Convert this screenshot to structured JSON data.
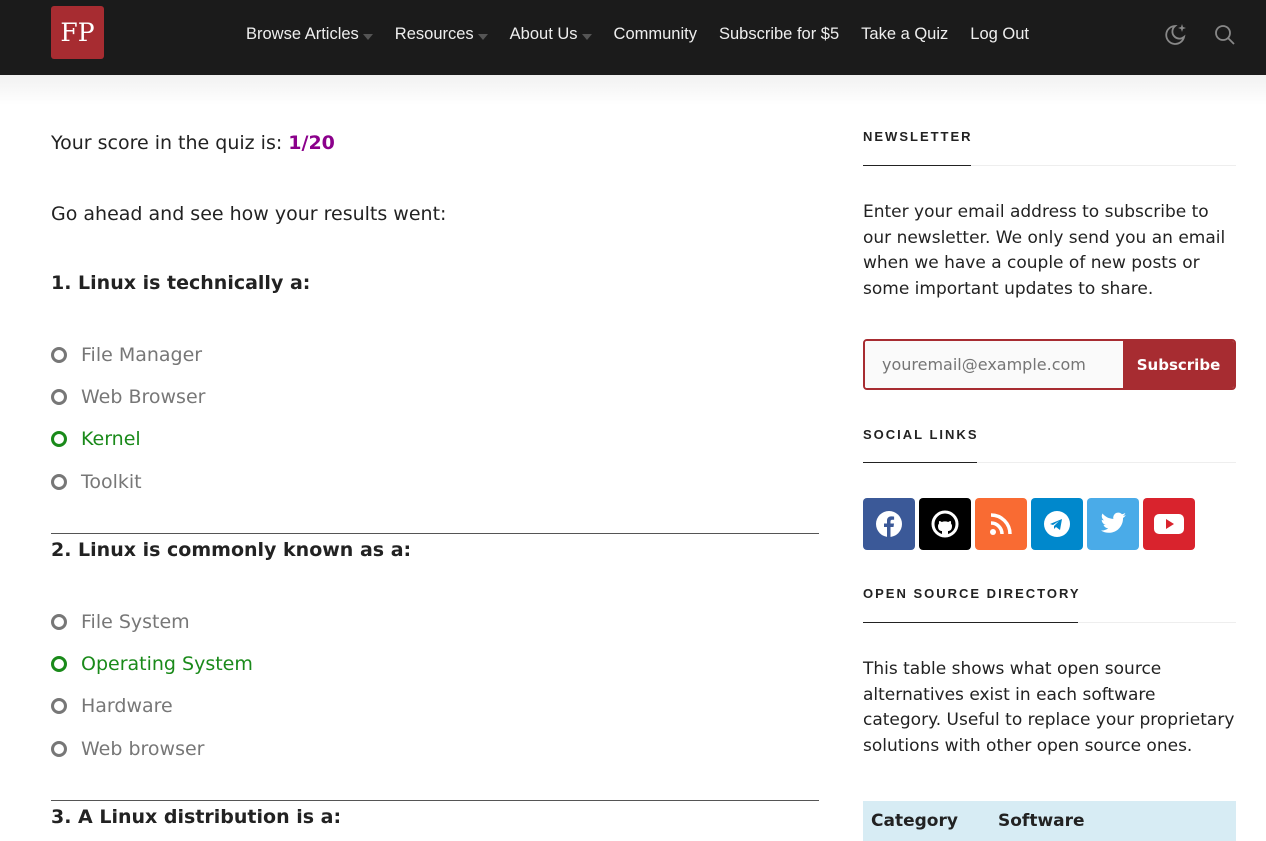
{
  "header": {
    "logo": "FP",
    "nav": [
      {
        "label": "Browse Articles",
        "dropdown": true
      },
      {
        "label": "Resources",
        "dropdown": true
      },
      {
        "label": "About Us",
        "dropdown": true
      },
      {
        "label": "Community"
      },
      {
        "label": "Subscribe for $5"
      },
      {
        "label": "Take a Quiz"
      },
      {
        "label": "Log Out"
      }
    ]
  },
  "main": {
    "score_label": "Your score in the quiz is:",
    "score": "1/20",
    "score_color": "#8b008b",
    "intro": "Go ahead and see how your results went:",
    "questions": [
      {
        "title": "1. Linux is technically a:",
        "options": [
          "File Manager",
          "Web Browser",
          "Kernel",
          "Toolkit"
        ],
        "correct": 2
      },
      {
        "title": "2. Linux is commonly known as a:",
        "options": [
          "File System",
          "Operating System",
          "Hardware",
          "Web browser"
        ],
        "correct": 1
      },
      {
        "title": "3. A Linux distribution is a:"
      }
    ]
  },
  "sidebar": {
    "newsletter": {
      "heading": "NEWSLETTER",
      "text": "Enter your email address to subscribe to our newsletter. We only send you an email when we have a couple of new posts or some important updates to share.",
      "placeholder": "youremail@example.com",
      "button": "Subscribe"
    },
    "social": {
      "heading": "SOCIAL LINKS",
      "links": [
        "facebook",
        "github",
        "rss",
        "telegram",
        "twitter",
        "youtube"
      ]
    },
    "directory": {
      "heading": "OPEN SOURCE DIRECTORY",
      "text": "This table shows what open source alternatives exist in each software category. Useful to replace your proprietary solutions with other open source ones.",
      "columns": [
        "Category",
        "Software"
      ]
    }
  }
}
